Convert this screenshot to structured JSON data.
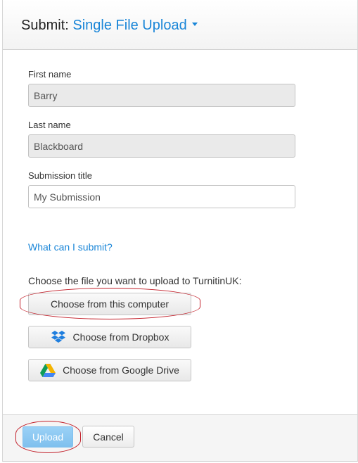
{
  "header": {
    "prefix": "Submit:",
    "submission_type": "Single File Upload"
  },
  "form": {
    "first_name": {
      "label": "First name",
      "value": "Barry"
    },
    "last_name": {
      "label": "Last name",
      "value": "Blackboard"
    },
    "submission_title": {
      "label": "Submission title",
      "value": "My Submission"
    }
  },
  "help_link": "What can I submit?",
  "upload": {
    "prompt": "Choose the file you want to upload to TurnitinUK:",
    "computer_label": "Choose from this computer",
    "dropbox_label": "Choose from Dropbox",
    "google_drive_label": "Choose from Google Drive"
  },
  "footer": {
    "upload_label": "Upload",
    "cancel_label": "Cancel"
  },
  "colors": {
    "accent": "#1a86d8",
    "upload_button": "#8ccaf2",
    "highlight_outline": "#c2202a",
    "dropbox": "#1f7ede"
  },
  "icons": {
    "dropbox": "dropbox-icon",
    "google_drive": "google-drive-icon",
    "dropdown": "chevron-down-icon"
  }
}
